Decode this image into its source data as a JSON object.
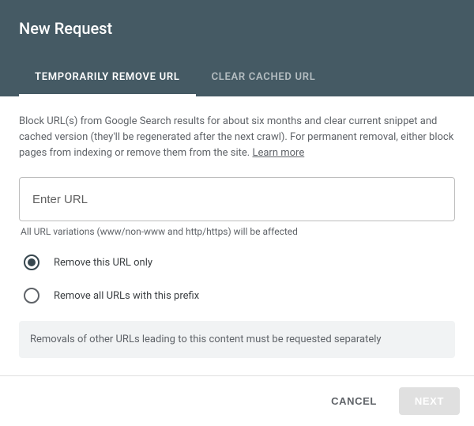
{
  "header": {
    "title": "New Request",
    "tabs": [
      {
        "label": "TEMPORARILY REMOVE URL",
        "active": true
      },
      {
        "label": "CLEAR CACHED URL",
        "active": false
      }
    ]
  },
  "content": {
    "description": "Block URL(s) from Google Search results for about six months and clear current snippet and cached version (they'll be regenerated after the next crawl). For permanent removal, either block pages from indexing or remove them from the site. ",
    "learn_more": "Learn more",
    "url_input": {
      "placeholder": "Enter URL",
      "value": ""
    },
    "help_text": "All URL variations (www/non-www and http/https) will be affected",
    "radios": [
      {
        "label": "Remove this URL only",
        "selected": true
      },
      {
        "label": "Remove all URLs with this prefix",
        "selected": false
      }
    ],
    "notice": "Removals of other URLs leading to this content must be requested separately"
  },
  "footer": {
    "cancel": "CANCEL",
    "next": "NEXT"
  }
}
